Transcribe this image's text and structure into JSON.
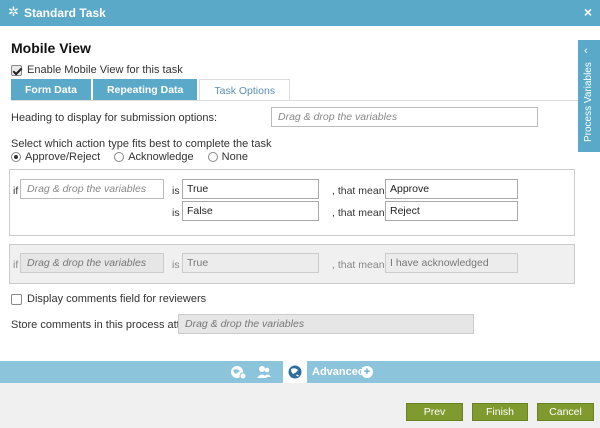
{
  "window": {
    "title": "Standard Task",
    "close_label": "×",
    "gear_glyph": "✲"
  },
  "page_title": "Mobile View",
  "enable_checkbox": {
    "label": "Enable Mobile View for this task",
    "checked": true
  },
  "tabs": [
    {
      "label": "Form Data",
      "active": false
    },
    {
      "label": "Repeating Data",
      "active": false
    },
    {
      "label": "Task Options",
      "active": true
    }
  ],
  "heading_label": "Heading to display for submission options:",
  "drag_placeholder": "Drag & drop the variables",
  "action_prompt": "Select which action type fits best to complete the task",
  "radios": [
    {
      "label": "Approve/Reject",
      "selected": true
    },
    {
      "label": "Acknowledge",
      "selected": false
    },
    {
      "label": "None",
      "selected": false
    }
  ],
  "approve_panel": {
    "if_label": "if",
    "is_label": "is",
    "means_label": ", that means",
    "row1": {
      "value": "True",
      "means": "Approve"
    },
    "row2": {
      "value": "False",
      "means": "Reject"
    }
  },
  "ack_panel": {
    "if_label": "if",
    "is_label": "is",
    "means_label": ", that means",
    "value": "True",
    "means": "I have acknowledged"
  },
  "comments_checkbox": {
    "label": "Display comments field for reviewers",
    "checked": false
  },
  "store_label": "Store comments in this process attribute:",
  "side_panel": {
    "label": "Process Variables",
    "arrow": "‹"
  },
  "bottom_bar": {
    "advanced_label": "Advanced",
    "plus": "+"
  },
  "buttons": {
    "prev": "Prev",
    "finish": "Finish",
    "cancel": "Cancel"
  },
  "colors": {
    "accent": "#5aa9c8",
    "button": "#7f9a2e",
    "bar": "#8cc4dc"
  }
}
